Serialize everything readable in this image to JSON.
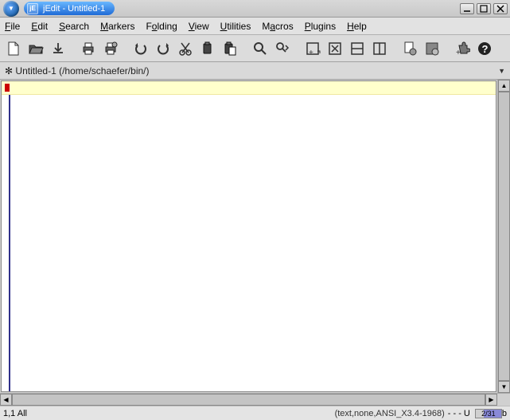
{
  "window": {
    "title": "jEdit - Untitled-1",
    "app_icon_text": "jE"
  },
  "menu": {
    "file": "File",
    "edit": "Edit",
    "search": "Search",
    "markers": "Markers",
    "folding": "Folding",
    "view": "View",
    "utilities": "Utilities",
    "macros": "Macros",
    "plugins": "Plugins",
    "help": "Help"
  },
  "buffer": {
    "label": "Untitled-1 (/home/schaefer/bin/)",
    "asterisk": "✻"
  },
  "status": {
    "pos": "1,1 All",
    "mode": "(text,none,ANSI_X3.4-1968)",
    "flags": "- - - U",
    "mem_label": "2/31",
    "mem_suffix": "b"
  }
}
